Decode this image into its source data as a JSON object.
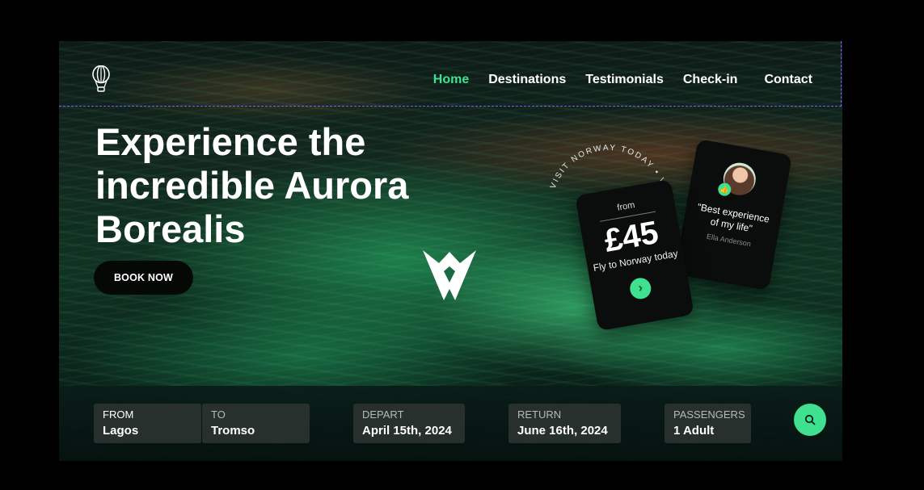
{
  "nav": {
    "items": [
      "Home",
      "Destinations",
      "Testimonials",
      "Check-in",
      "Contact"
    ],
    "active_index": 0
  },
  "hero": {
    "title": "Experience the incredible Aurora Borealis",
    "cta": "BOOK NOW"
  },
  "badge": {
    "circle_text": "VISIT NORWAY TODAY • VISIT NORWAY TODAY •"
  },
  "price_card": {
    "from": "from",
    "price": "£45",
    "subtitle": "Fly to Norway today"
  },
  "review_card": {
    "quote": "\"Best experience of my life\"",
    "author": "Ella Anderson"
  },
  "search": {
    "fields": [
      {
        "label": "FROM",
        "value": "Lagos"
      },
      {
        "label": "TO",
        "value": "Tromso"
      },
      {
        "label": "DEPART",
        "value": "April 15th, 2024"
      },
      {
        "label": "RETURN",
        "value": "June 16th, 2024"
      },
      {
        "label": "PASSENGERS",
        "value": "1 Adult"
      }
    ]
  },
  "colors": {
    "accent": "#3fe08f",
    "card": "#0a0d0c",
    "field_bg": "#27302d"
  },
  "icons": [
    "hot-air-balloon-icon",
    "brand-v-logo-icon",
    "chevron-right-icon",
    "thumbs-up-icon",
    "search-icon"
  ]
}
